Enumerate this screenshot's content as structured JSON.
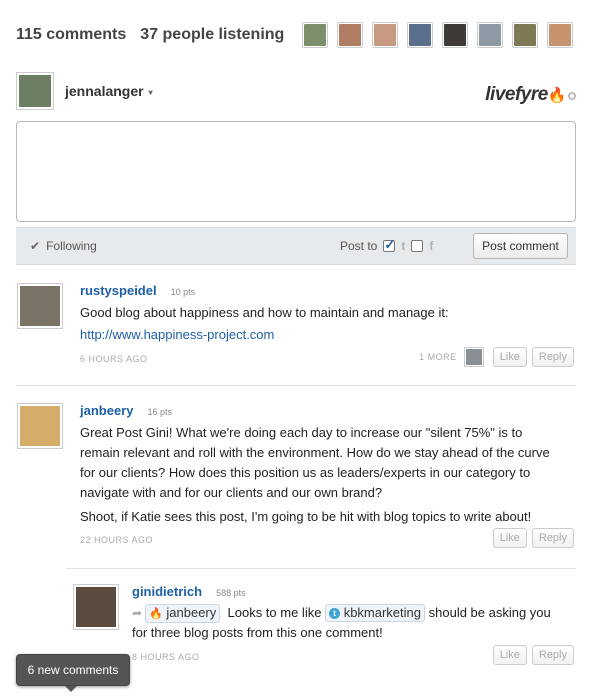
{
  "header": {
    "comment_count": "115 comments",
    "listener_count": "37 people listening",
    "listeners": [
      {
        "color": "#7b8f6a"
      },
      {
        "color": "#b07c62"
      },
      {
        "color": "#c99a82"
      },
      {
        "color": "#5a6f8c"
      },
      {
        "color": "#3e3a36"
      },
      {
        "color": "#8e9aa3"
      },
      {
        "color": "#7d7a55"
      },
      {
        "color": "#c7926e"
      }
    ]
  },
  "user": {
    "name": "jennalanger",
    "caret": "▾",
    "avatar_color": "#6d7f63"
  },
  "brand": {
    "name": "livefyre",
    "flame": "🔥"
  },
  "toolbar": {
    "following": "Following",
    "check": "✔",
    "post_to": "Post to",
    "twitter_glyph": "t",
    "facebook_glyph": "f",
    "post_button": "Post comment"
  },
  "comments": [
    {
      "author": "rustyspeidel",
      "points": "10 pts",
      "text": "Good blog about happiness and how to maintain and manage it:",
      "link": "http://www.happiness-project.com",
      "time": "6 HOURS AGO",
      "more": "1 MORE",
      "like": "Like",
      "reply": "Reply",
      "avatar_color": "#7a7466"
    },
    {
      "author": "janbeery",
      "points": "16 pts",
      "text": "Great Post Gini! What we're doing each day to increase our \"silent 75%\" is to remain relevant and roll with the environment. How do we stay ahead of the curve for our clients? How does this position us as leaders/experts in our category to navigate with and for our clients and our own brand?",
      "text2": "Shoot, if Katie sees this post, I'm going to be hit with blog topics to write about!",
      "time": "22 HOURS AGO",
      "like": "Like",
      "reply": "Reply",
      "avatar_color": "#d6ae6c"
    },
    {
      "author": "ginidietrich",
      "points": "588 pts",
      "mention1": "janbeery",
      "text_a": "Looks to me like",
      "mention2": "kbkmarketing",
      "text_b": "should be asking you for three blog posts from this one comment!",
      "time": "8 HOURS AGO",
      "like": "Like",
      "reply": "Reply",
      "avatar_color": "#5b4a3e"
    }
  ],
  "toast": {
    "label": "6 new comments"
  }
}
